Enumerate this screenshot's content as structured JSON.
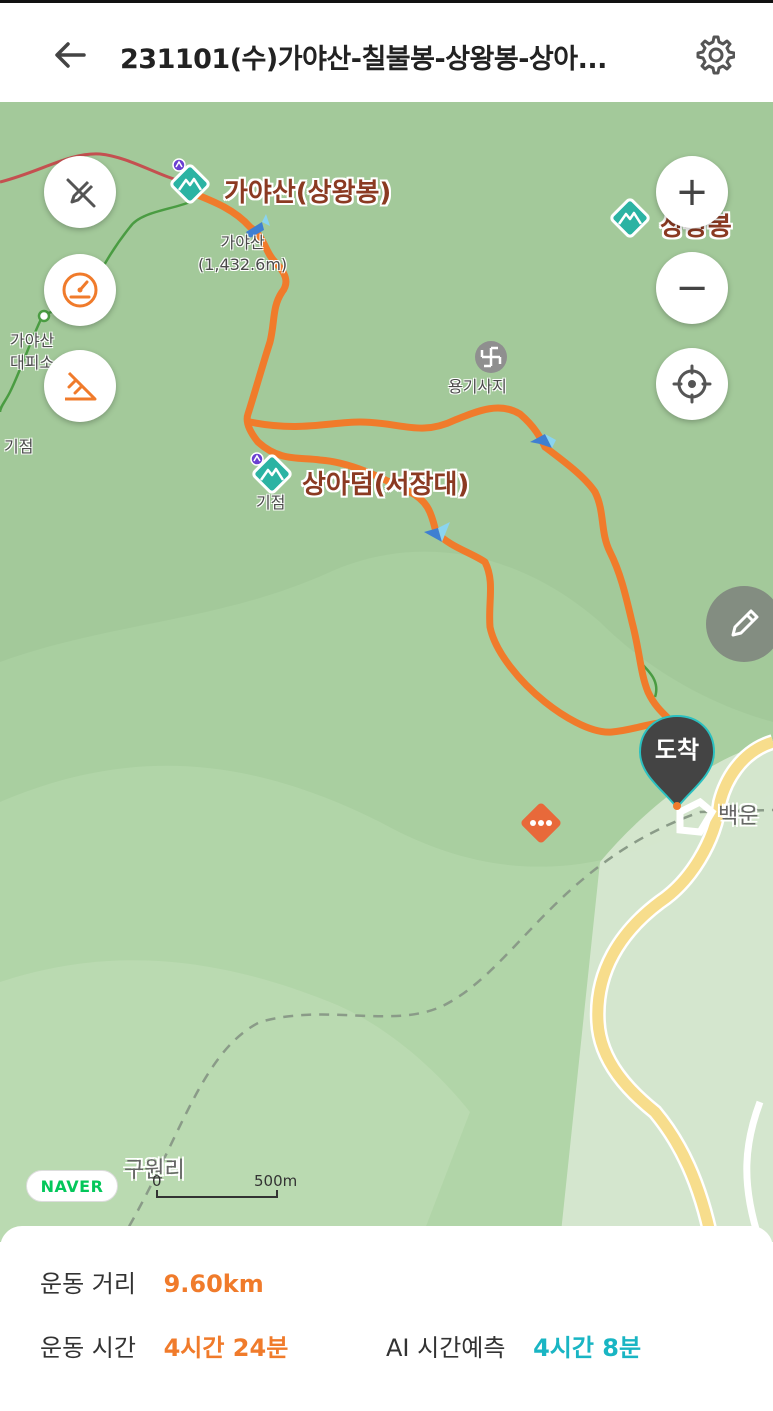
{
  "header": {
    "title": "231101(수)가야산-칠불봉-상왕봉-상아...",
    "back_icon": "back-arrow-icon",
    "settings_icon": "gear-icon"
  },
  "map": {
    "labels": {
      "peak_main": "가야산(상왕봉)",
      "peak_main_sub_name": "가야산",
      "peak_main_sub_elev": "(1,432.6m)",
      "peak_right": "상왕봉",
      "peak_sangadeom": "상아덤(서장대)",
      "sangadeom_sub": "기점",
      "temple": "용기사지",
      "shelter_line1": "가야산",
      "shelter_line2": "대피소",
      "left_start": "기점",
      "village_right": "백운",
      "village_bottom": "구원리"
    },
    "controls": {
      "zoom_in": "+",
      "zoom_out": "−"
    },
    "arrival_label": "도착",
    "naver_logo": "NAVER",
    "scale": {
      "start": "0",
      "end": "500m"
    },
    "colors": {
      "route": "#f07b2b",
      "peak_badge": "#2bb3a3",
      "arrival_pin": "#444444"
    }
  },
  "stats": {
    "distance_label": "운동 거리",
    "distance_value": "9.60km",
    "time_label": "운동 시간",
    "time_value": "4시간 24분",
    "ai_label": "AI 시간예측",
    "ai_value": "4시간 8분"
  }
}
